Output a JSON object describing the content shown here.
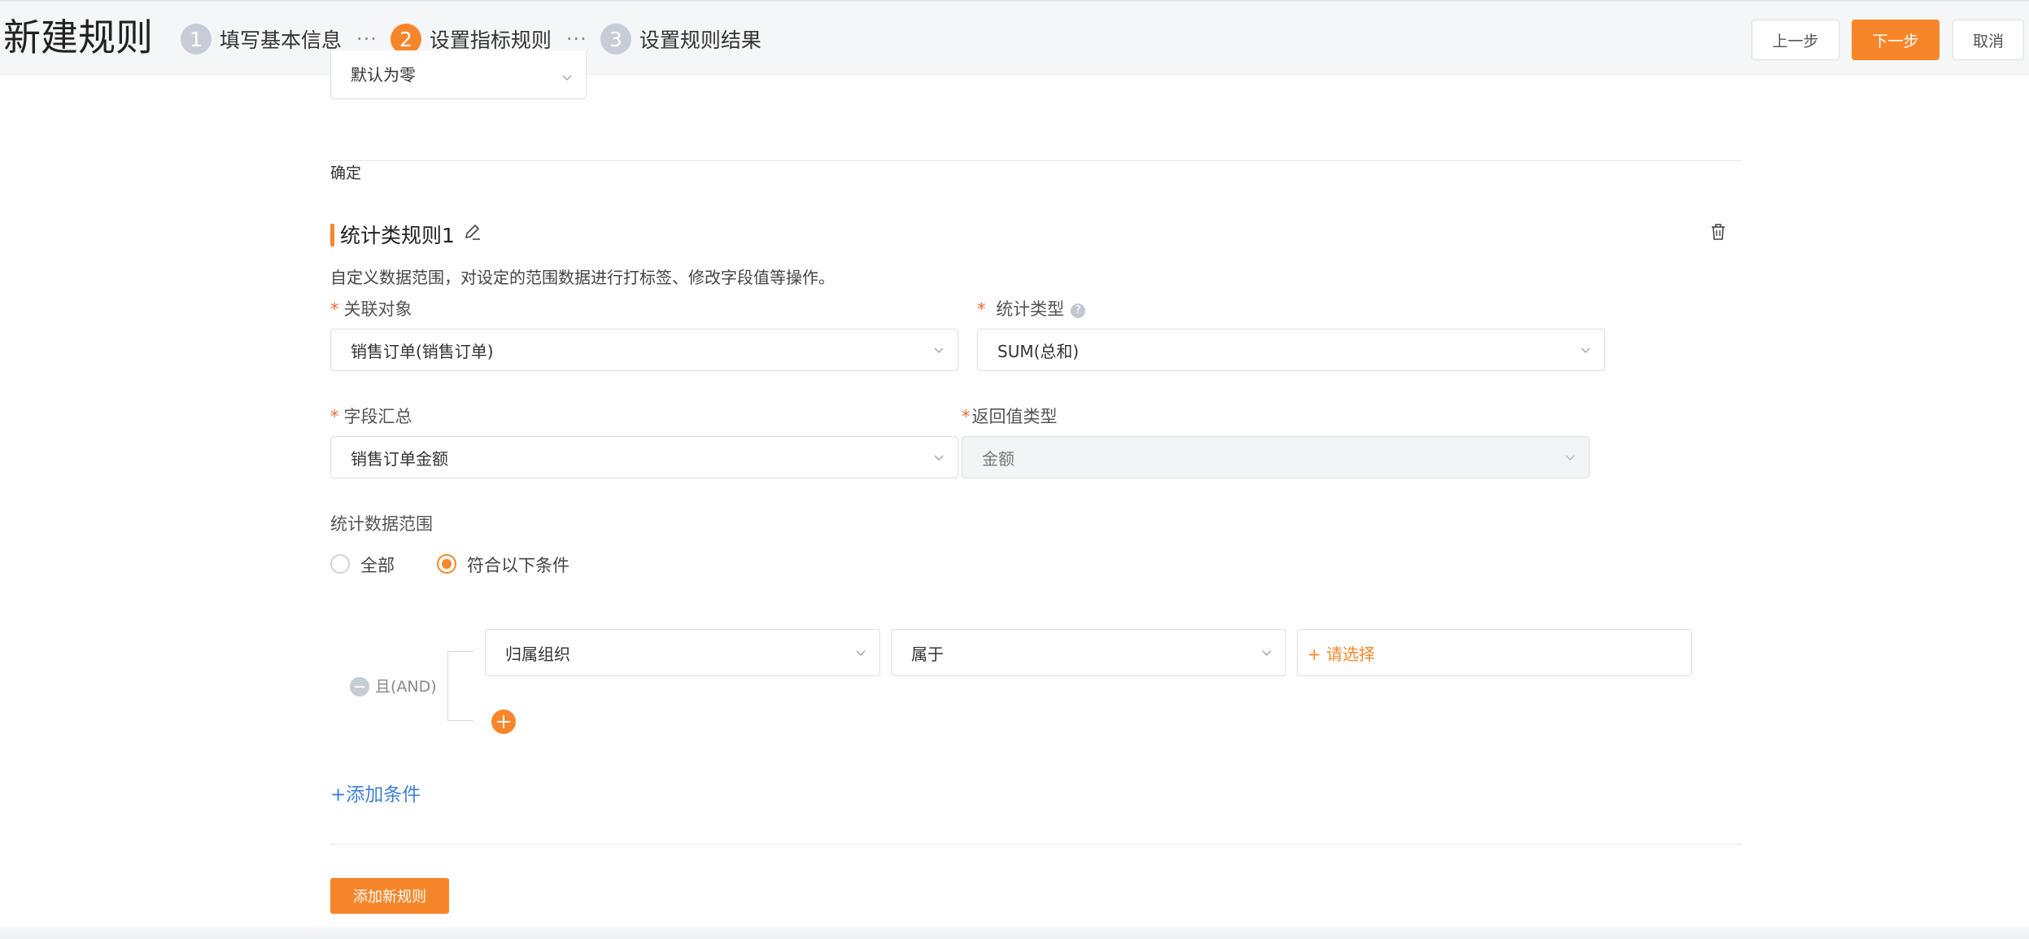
{
  "header": {
    "title": "新建规则",
    "steps": [
      {
        "num": "1",
        "label": "填写基本信息"
      },
      {
        "num": "2",
        "label": "设置指标规则"
      },
      {
        "num": "3",
        "label": "设置规则结果"
      }
    ],
    "step_separator": "···",
    "prev_label": "上一步",
    "next_label": "下一步",
    "cancel_label": "取消"
  },
  "above": {
    "partial_select_value": "默认为零",
    "confirm_text": "确定"
  },
  "rule": {
    "title": "统计类规则1",
    "description": "自定义数据范围，对设定的范围数据进行打标签、修改字段值等操作。",
    "required_mark": "*",
    "fields": {
      "related_object": {
        "label": "关联对象",
        "value": "销售订单(销售订单)"
      },
      "stat_type": {
        "label": "统计类型",
        "value": "SUM(总和)",
        "help": "?"
      },
      "field_summary": {
        "label": "字段汇总",
        "value": "销售订单金额"
      },
      "return_type": {
        "label": "返回值类型",
        "value": "金额"
      }
    },
    "scope": {
      "label": "统计数据范围",
      "options": [
        "全部",
        "符合以下条件"
      ],
      "selected": "符合以下条件"
    },
    "condition_group": {
      "logic_label": "且(AND)",
      "conditions": [
        {
          "field": "归属组织",
          "operator": "属于",
          "value_placeholder": "+ 请选择"
        }
      ]
    },
    "add_condition_label": "+添加条件"
  },
  "add_rule_label": "添加新规则",
  "colors": {
    "accent": "#f7862b",
    "link": "#3d7fd9",
    "required": "#f26b3a"
  }
}
